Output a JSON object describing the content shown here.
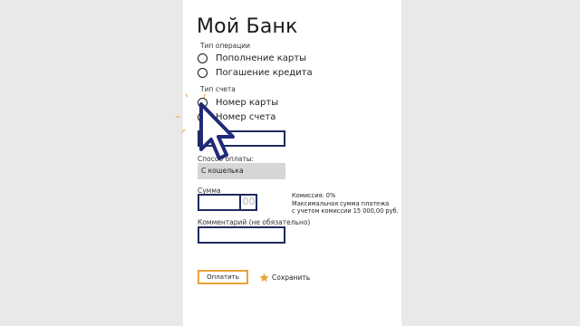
{
  "app": {
    "title": "Мой Банк"
  },
  "operation": {
    "label": "Тип операции",
    "options": [
      {
        "label": "Пополнение карты",
        "checked": false
      },
      {
        "label": "Погашение кредита",
        "checked": false
      }
    ]
  },
  "account": {
    "label": "Тип счета",
    "options": [
      {
        "label": "Номер карты",
        "checked": false
      },
      {
        "label": "Номер счета",
        "checked": true
      }
    ],
    "value": ""
  },
  "payment_method": {
    "label": "Способ оплаты:",
    "selected": "С кошелька"
  },
  "amount": {
    "label": "Сумма",
    "value": "",
    "cents": "00"
  },
  "info": {
    "commission": "Комиссия: 0%",
    "max_line1": "Максимальная сумма платежа",
    "max_line2": "с учетом комиссии 15 000,00 руб."
  },
  "comment": {
    "label": "Комментарий (не обязательно)",
    "value": ""
  },
  "actions": {
    "pay_label": "Оплатить",
    "save_label": "Сохранить"
  },
  "colors": {
    "accent": "#e8a33a",
    "border": "#1f2a5e",
    "cursor": "#1f2a7a"
  },
  "icons": {
    "save": "star-icon",
    "pointer": "mouse-cursor-icon"
  }
}
